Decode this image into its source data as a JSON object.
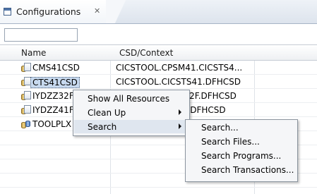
{
  "view": {
    "tab_title": "Configurations",
    "tab_close_glyph": "✕",
    "tab_icon": "table-view-icon",
    "filter_value": ""
  },
  "table": {
    "columns": [
      "Name",
      "CSD/Context"
    ],
    "rows": [
      {
        "name": "CMS41CSD",
        "context": "CICSTOOL.CPSM41.CICSTS4...",
        "icon": "csd-file-icon"
      },
      {
        "name": "CTS41CSD",
        "context": "CICSTOOL.CICSTS41.DFHCSD",
        "icon": "csd-file-icon"
      },
      {
        "name": "IYDZZ32F",
        "context": "...32F.DFHCSD",
        "icon": "csd-file-icon"
      },
      {
        "name": "IYDZZ41F",
        "context": "...F.DFHCSD",
        "icon": "csd-file-icon"
      },
      {
        "name": "TOOLPLX",
        "context": "",
        "icon": "plex-group-icon"
      }
    ]
  },
  "context_menu": {
    "items": [
      {
        "label": "Show All Resources",
        "has_submenu": false
      },
      {
        "label": "Clean Up",
        "has_submenu": true
      },
      {
        "label": "Search",
        "has_submenu": true
      }
    ]
  },
  "search_submenu": {
    "items": [
      "Search...",
      "Search Files...",
      "Search Programs...",
      "Search Transactions..."
    ]
  },
  "colors": {
    "selection": "#c7d9ef",
    "menu_background": "#f5f6f8",
    "tab_border": "#a7b4c6"
  }
}
